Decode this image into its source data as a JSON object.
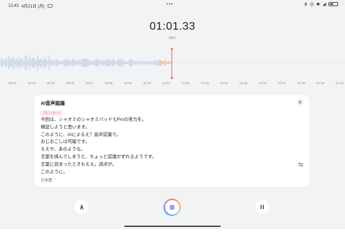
{
  "status_bar": {
    "time": "13:43",
    "date": "4月21日 (月)",
    "dots": "•••",
    "battery_level": 0.5,
    "icons": [
      "bluetooth-icon",
      "alarm-icon",
      "wifi-icon",
      "signal-icon",
      "battery-icon"
    ]
  },
  "recorder": {
    "elapsed": "01:01.33",
    "sub_label": "録音中"
  },
  "timeline": {
    "ticks": [
      "00:03",
      "00:04",
      "00:05",
      "00:06",
      "00:07",
      "00:08",
      "00:09",
      "01:00",
      "01:01",
      "01:02",
      "01:03",
      "01:04",
      "01:05",
      "01:06",
      "01:07",
      "01:08",
      "01:09",
      "01:10"
    ],
    "playhead_at": "01:01"
  },
  "transcript_card": {
    "title": "AI音声認識",
    "speaker_tag": "スピーカー1",
    "lines": [
      "今回は、シャオミのシャオミパッド七Proの実力を。",
      "検証しようと思います。",
      "このように、AIによるえ？音声認識で。",
      "おじおこしは可能です。",
      "ええや、あのような。",
      "言葉を挟んでしまうと、ちょっと認識がずれるようです。",
      "言葉に詰まったときもええ。読点が。",
      "このように。"
    ],
    "language": "日本語",
    "language_chevron": "⌃"
  },
  "controls": {
    "left": "flag-icon",
    "center": "stop-recording-button",
    "right": "pause-icon"
  },
  "colors": {
    "waveform": "#b9c8e2",
    "waveform_active": "#f29b6b",
    "playhead": "#e03e36",
    "tag_bg": "#fbe9f1",
    "tag_text": "#d55a8c"
  }
}
